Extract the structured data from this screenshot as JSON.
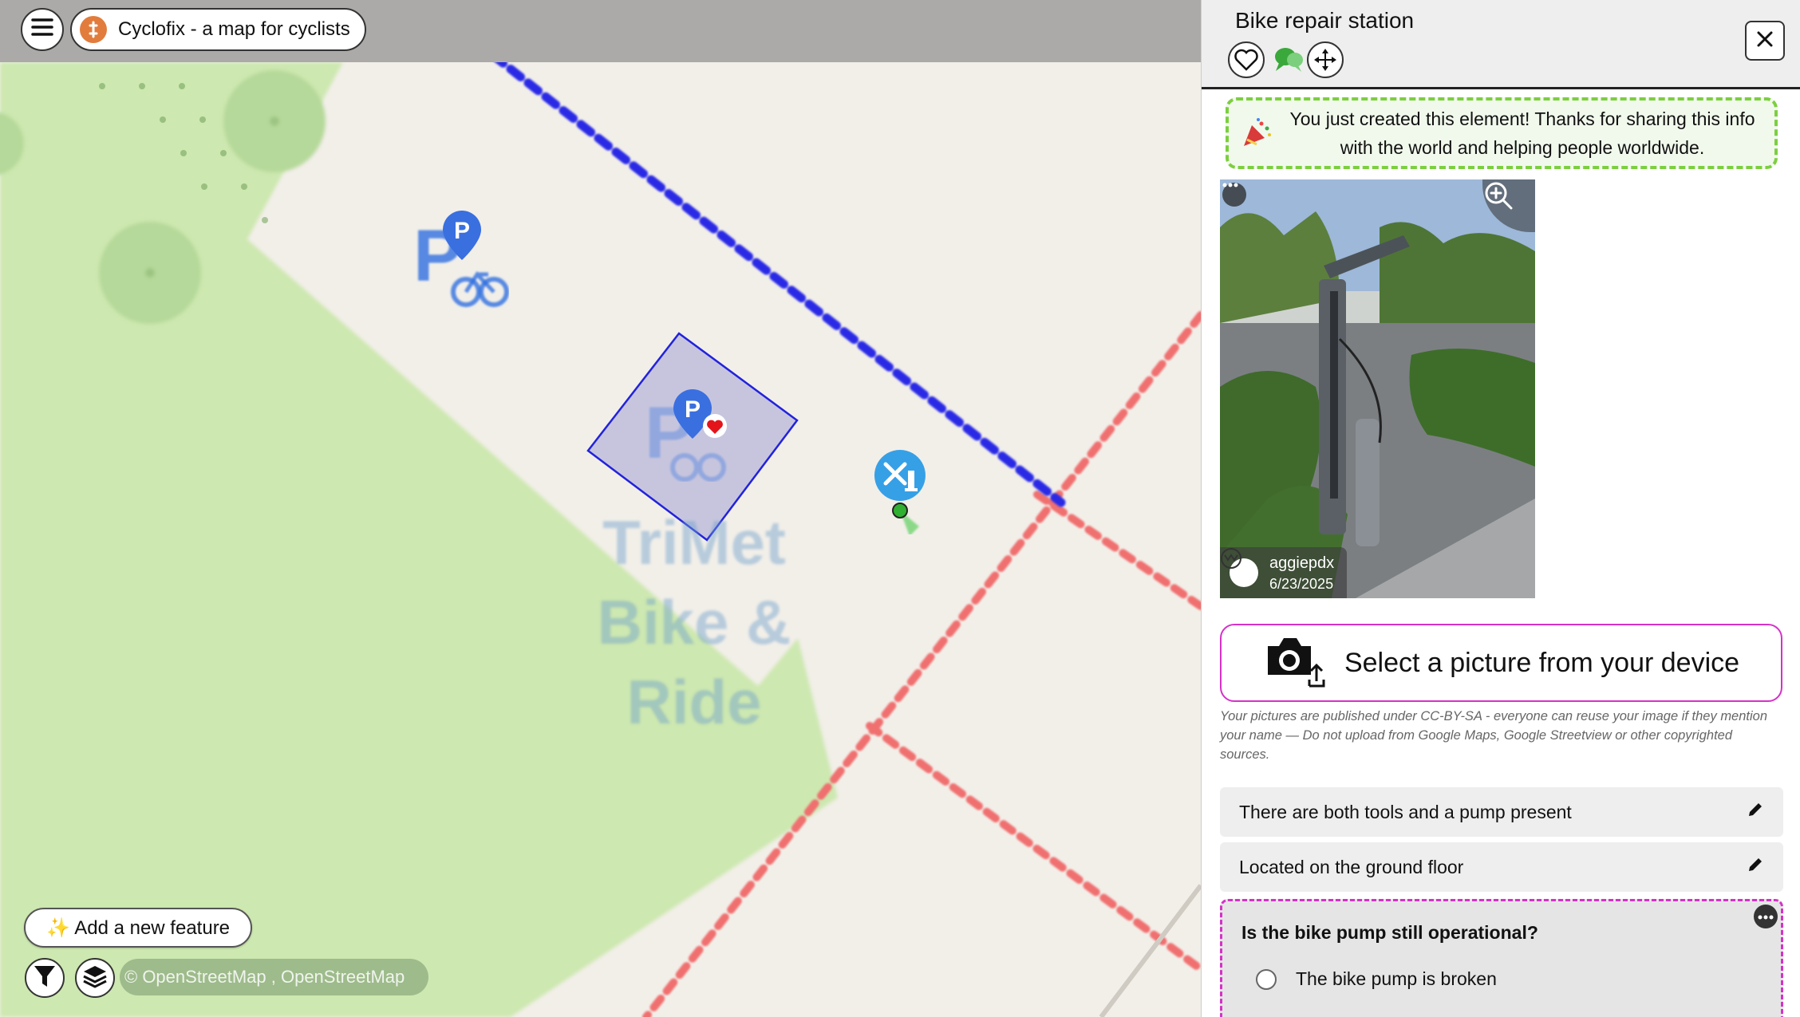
{
  "app": {
    "title": "Cyclofix - a map for cyclists",
    "menu_icon": "hamburger-icon",
    "logo_icon": "cyclofix-logo-icon"
  },
  "map": {
    "area_label_line1": "TriMet",
    "area_label_line2": "Bike &",
    "area_label_line3": "Ride",
    "add_feature_label": "✨ Add a new feature",
    "attribution": "© OpenStreetMap , OpenStreetMap",
    "filter_icon": "filter-icon",
    "layers_icon": "layers-icon",
    "markers": [
      "bicycle-parking-icon",
      "bicycle-parking-favourite-icon",
      "bike-repair-station-icon"
    ],
    "colors": {
      "green_area": "#cde8b0",
      "cycleway": "#2020e0",
      "footway": "#f07070",
      "selected_polygon": "#2020e0"
    }
  },
  "panel": {
    "title": "Bike repair station",
    "header_icons": [
      "heart-icon",
      "speech-bubble-icon",
      "move-icon"
    ],
    "close_icon": "close-icon",
    "thanks_message": "You just created this element! Thanks for sharing this info with the world and helping people worldwide.",
    "thanks_icon": "party-popper-icon",
    "photo": {
      "author": "aggiepdx",
      "date": "6/23/2025",
      "more_icon": "more-icon",
      "zoom_icon": "zoom-in-icon"
    },
    "upload": {
      "label": "Select a picture from your device",
      "icon": "camera-upload-icon"
    },
    "license_text": "Your pictures are published under CC-BY-SA - everyone can reuse your image if they mention your name  —  Do not upload from Google Maps, Google Streetview or other copyrighted sources.",
    "answers": [
      {
        "text": "There are both tools and a pump present",
        "icon": "pencil-icon"
      },
      {
        "text": "Located on the ground floor",
        "icon": "pencil-icon"
      }
    ],
    "question": {
      "text": "Is the bike pump still operational?",
      "options": [
        "The bike pump is broken"
      ]
    },
    "colors": {
      "accent_magenta": "#d631c8",
      "success_green": "#7ccf3f"
    }
  }
}
